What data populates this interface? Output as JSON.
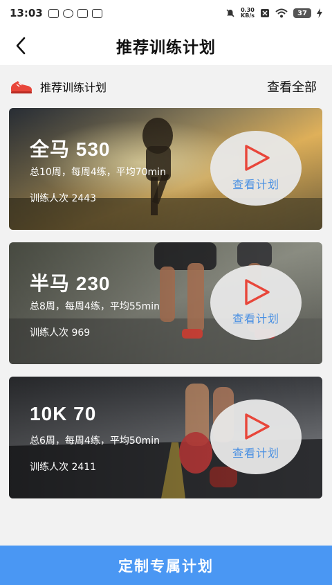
{
  "status_bar": {
    "time": "13:03",
    "net_speed_value": "0.30",
    "net_speed_unit": "KB/s",
    "battery": "37"
  },
  "header": {
    "title": "推荐训练计划"
  },
  "section": {
    "title": "推荐训练计划",
    "view_all": "查看全部"
  },
  "plans": [
    {
      "name": "全马 530",
      "desc": "总10周，每周4练，平均70min",
      "count": "训练人次 2443",
      "action": "查看计划"
    },
    {
      "name": "半马 230",
      "desc": "总8周，每周4练，平均55min",
      "count": "训练人次 969",
      "action": "查看计划"
    },
    {
      "name": "10K 70",
      "desc": "总6周，每周4练，平均50min",
      "count": "训练人次 2411",
      "action": "查看计划"
    }
  ],
  "bottom_button": {
    "label": "定制专属计划"
  },
  "colors": {
    "accent": "#4a97f3",
    "play_triangle": "#e8463a",
    "play_label": "#4a90e2"
  }
}
